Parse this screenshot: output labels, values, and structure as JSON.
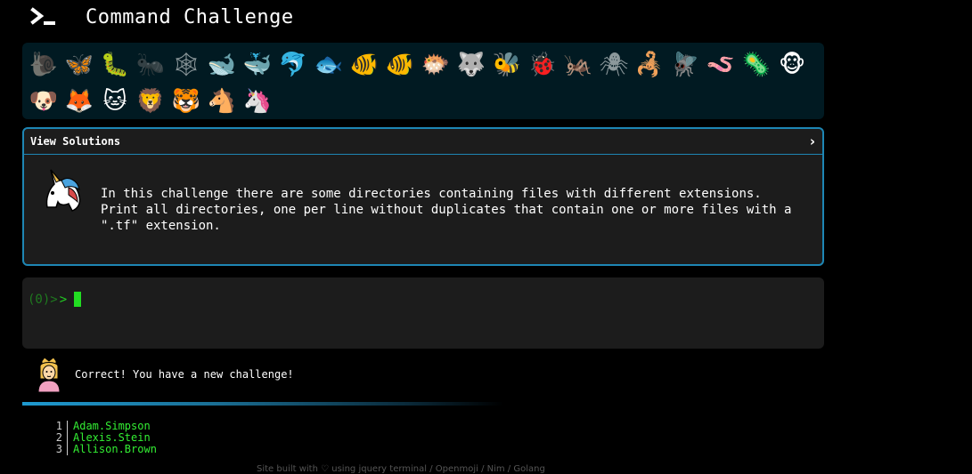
{
  "header": {
    "title": "Command Challenge",
    "logo_icon": "terminal-prompt-icon"
  },
  "animals": [
    {
      "name": "snail",
      "glyph": "🐌",
      "dim": true
    },
    {
      "name": "butterfly",
      "glyph": "🦋",
      "dim": false
    },
    {
      "name": "bug",
      "glyph": "🐛",
      "dim": false
    },
    {
      "name": "ant",
      "glyph": "🐜",
      "dim": true
    },
    {
      "name": "spider-web",
      "glyph": "🕸",
      "dim": true
    },
    {
      "name": "whale",
      "glyph": "🐋",
      "dim": false
    },
    {
      "name": "whale-2",
      "glyph": "🐳",
      "dim": false
    },
    {
      "name": "dolphin",
      "glyph": "🐬",
      "dim": false
    },
    {
      "name": "fish",
      "glyph": "🐟",
      "dim": false
    },
    {
      "name": "fish-2",
      "glyph": "🐠",
      "dim": false
    },
    {
      "name": "tropical-fish",
      "glyph": "🐠",
      "dim": false
    },
    {
      "name": "blowfish",
      "glyph": "🐡",
      "dim": false
    },
    {
      "name": "wolf",
      "glyph": "🐺",
      "dim": false
    },
    {
      "name": "bee",
      "glyph": "🐝",
      "dim": false
    },
    {
      "name": "lady-beetle",
      "glyph": "🐞",
      "dim": false
    },
    {
      "name": "cricket",
      "glyph": "🦗",
      "dim": false
    },
    {
      "name": "spider",
      "glyph": "🕷",
      "dim": true
    },
    {
      "name": "scorpion",
      "glyph": "🦂",
      "dim": false
    },
    {
      "name": "fly",
      "glyph": "🪰",
      "dim": false
    },
    {
      "name": "worm",
      "glyph": "🪱",
      "dim": false
    },
    {
      "name": "microbe",
      "glyph": "🦠",
      "dim": false
    },
    {
      "name": "monkey",
      "glyph": "🐵",
      "dim": false
    },
    {
      "name": "dog",
      "glyph": "🐶",
      "dim": false
    },
    {
      "name": "fox",
      "glyph": "🦊",
      "dim": false
    },
    {
      "name": "cat",
      "glyph": "🐱",
      "dim": false
    },
    {
      "name": "lion",
      "glyph": "🦁",
      "dim": false
    },
    {
      "name": "tiger",
      "glyph": "🐯",
      "dim": false
    },
    {
      "name": "horse",
      "glyph": "🐴",
      "dim": false
    },
    {
      "name": "unicorn",
      "glyph": "🦄",
      "dim": false
    }
  ],
  "solutions": {
    "toggle_label": "View Solutions",
    "chevron": "›",
    "avatar_icon": "unicorn-icon",
    "challenge_text": "In this challenge there are some directories containing files with different extensions.\nPrint all directories, one per line without duplicates that contain one or more files with a\n\".tf\" extension."
  },
  "terminal": {
    "prompt_count": "(0)>",
    "prompt_arrow": ">"
  },
  "feedback": {
    "avatar_icon": "princess-icon",
    "message": "Correct! You have a new challenge!"
  },
  "output": {
    "lines": [
      {
        "num": "1",
        "text": "Adam.Simpson"
      },
      {
        "num": "2",
        "text": "Alexis.Stein"
      },
      {
        "num": "3",
        "text": "Allison.Brown"
      }
    ]
  },
  "footer": {
    "text": "Site built with ♡ using jquery terminal / Openmoji / Nim / Golang"
  }
}
